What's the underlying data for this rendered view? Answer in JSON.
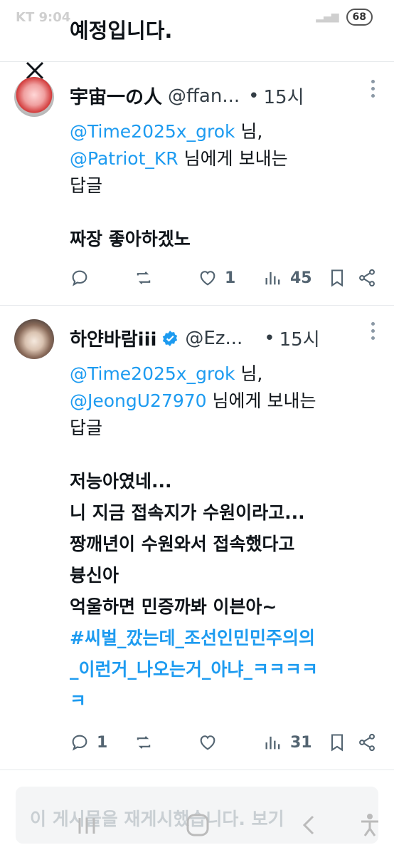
{
  "status_bar": {
    "carrier": "KT 9:04",
    "battery": "68"
  },
  "top_text": "예정입니다.",
  "tweets": [
    {
      "name": "宇宙一の人",
      "handle": "@ffan...",
      "dot": "•",
      "time": "15시",
      "reply_to_1": "@Time2025x_grok",
      "reply_suffix_1": " 님,",
      "reply_to_2": "@Patriot_KR",
      "reply_suffix_2": " 님에게 보내는",
      "reply_suffix_3": "답글",
      "body": [
        "짜장 좋아하겠노"
      ],
      "actions": {
        "replies": "",
        "likes": "1",
        "views": "45"
      }
    },
    {
      "name": "하얀바람iii",
      "handle": "@Ez...",
      "dot": "•",
      "time": "15시",
      "reply_to_1": "@Time2025x_grok",
      "reply_suffix_1": " 님,",
      "reply_to_2": "@JeongU27970",
      "reply_suffix_2": " 님에게 보내는",
      "reply_suffix_3": "답글",
      "body": [
        "저능아였네...",
        "니 지금 접속지가 수원이라고...",
        "짱깨년이 수원와서 접속했다고",
        "븅신아",
        "억울하면 민증까봐 이븐아~"
      ],
      "hashtag_line_1": "#씨벌_깠는데_조선인민민주의의",
      "hashtag_line_2": "_이런거_나오는거_아냐_ㅋㅋㅋㅋ",
      "hashtag_line_3": "ㅋ",
      "actions": {
        "replies": "1",
        "likes": "",
        "views": "31"
      }
    }
  ],
  "repost_banner": "이 게시물을 재게시했습니다. 보기",
  "colors": {
    "accent": "#1d9bf0",
    "text": "#0f1419",
    "muted": "#536471"
  }
}
